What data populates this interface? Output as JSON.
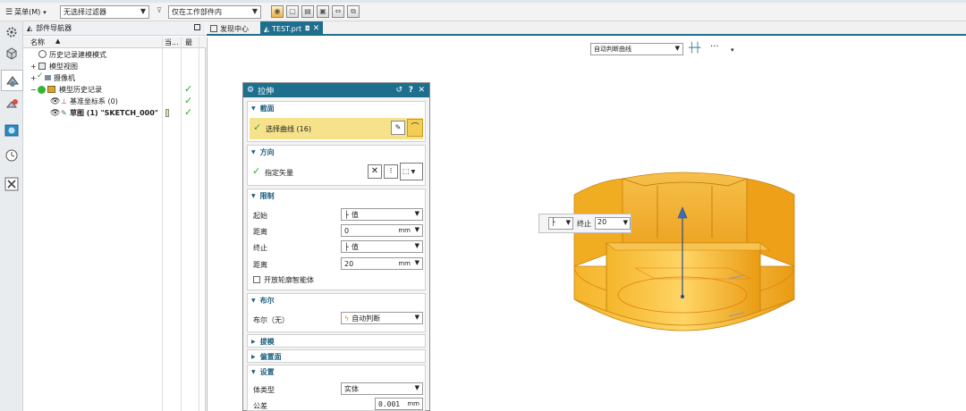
{
  "toolbar": {
    "menu_label": "菜单(M)",
    "filter_value": "无选择过滤器",
    "scope_value": "仅在工作部件内"
  },
  "navigator": {
    "title": "部件导航器",
    "col_name": "名称",
    "col_current": "当...",
    "col_latest": "最",
    "rows": [
      {
        "label": "历史记录建模模式",
        "checked": false
      },
      {
        "label": "模型视图",
        "checked": false
      },
      {
        "label": "摄像机",
        "checked": false
      },
      {
        "label": "模型历史记录",
        "checked": true
      },
      {
        "label": "基准坐标系 (0)",
        "checked": true
      },
      {
        "label": "草图 (1) \"SKETCH_000\"",
        "checked": true
      }
    ]
  },
  "tabs": [
    {
      "label": "发现中心",
      "active": false
    },
    {
      "label": "TEST.prt",
      "active": true
    }
  ],
  "float_toolbar": {
    "curve_rule": "自动判断曲线"
  },
  "dialog": {
    "title": "拉伸",
    "section_profile": "截面",
    "select_curve": "选择曲线 (16)",
    "section_direction": "方向",
    "specify_vector": "指定矢量",
    "section_limits": "限制",
    "start_label": "起始",
    "start_value": "值",
    "distance_label": "距离",
    "start_distance": "0",
    "end_label": "终止",
    "end_value": "值",
    "end_distance": "20",
    "unit": "mm",
    "open_profile": "开放轮廓智能体",
    "section_boolean": "布尔",
    "boolean_label": "布尔（无）",
    "boolean_value": "自动判断",
    "section_draft": "拔模",
    "section_offset": "偏置面",
    "section_settings": "设置",
    "body_type_label": "体类型",
    "body_type_value": "实体",
    "tolerance_label": "公差",
    "tolerance_value": "0.001"
  },
  "handle": {
    "label": "终止",
    "value": "20"
  },
  "colors": {
    "accent": "#1e6f8e",
    "selection_highlight": "#f6e28a",
    "part_orange": "#f2a81d",
    "check_green": "#2ea82e"
  }
}
